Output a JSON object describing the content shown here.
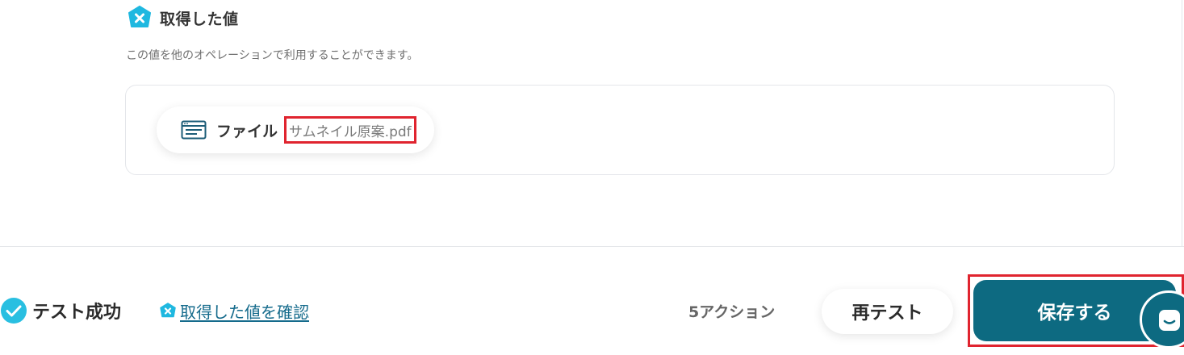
{
  "result_section": {
    "title": "取得した値",
    "description": "この値を他のオペレーションで利用することができます。",
    "field": {
      "label": "ファイル",
      "value": "サムネイル原案.pdf"
    }
  },
  "footer": {
    "status": "テスト成功",
    "view_values_link": "取得した値を確認",
    "action_count": "5アクション",
    "retest_label": "再テスト",
    "save_label": "保存する"
  },
  "icons": {
    "section_badge": "yoom-badge-icon",
    "field": "file-window-icon",
    "status": "check-circle-icon",
    "link_badge": "yoom-badge-icon",
    "chat": "chat-launcher-icon"
  },
  "colors": {
    "accent_teal": "#0d6a81",
    "badge_cyan": "#1fb8e0",
    "link": "#156b8c",
    "highlight_red": "#e0242f"
  }
}
